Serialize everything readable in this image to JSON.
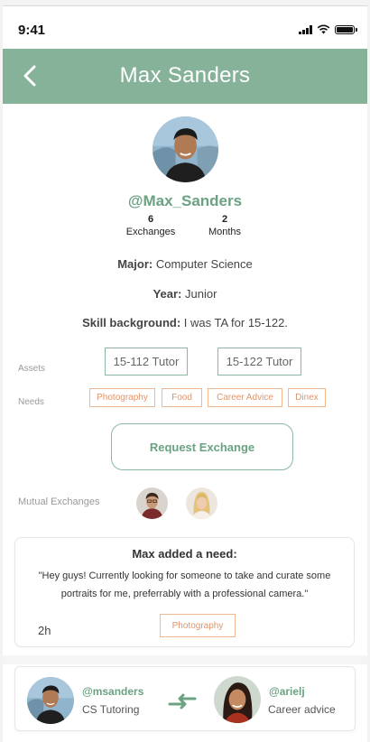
{
  "status_bar": {
    "time": "9:41"
  },
  "header": {
    "title": "Max Sanders",
    "back_icon": "chevron-left-icon"
  },
  "profile": {
    "handle": "@Max_Sanders",
    "stats": [
      {
        "value": "6",
        "label": "Exchanges"
      },
      {
        "value": "2",
        "label": "Months"
      }
    ],
    "major_label": "Major:",
    "major_value": "Computer Science",
    "year_label": "Year:",
    "year_value": "Junior",
    "skill_label": "Skill background:",
    "skill_value": "I was TA for 15-122."
  },
  "assets": {
    "label": "Assets",
    "items": [
      "15-112 Tutor",
      "15-122 Tutor"
    ]
  },
  "needs": {
    "label": "Needs",
    "items": [
      "Photography",
      "Food",
      "Career Advice",
      "Dinex"
    ]
  },
  "request_button": "Request Exchange",
  "mutual": {
    "label": "Mutual Exchanges"
  },
  "activity": {
    "title": "Max added a need:",
    "text": "\"Hey guys! Currently looking for someone to take and curate some portraits for me, preferrably with a professional camera.\"",
    "time": "2h",
    "tag": "Photography"
  },
  "exchange": {
    "left_handle": "@msanders",
    "left_skill": "CS Tutoring",
    "right_handle": "@arielj",
    "right_skill": "Career advice",
    "icon": "swap-arrows-icon"
  },
  "colors": {
    "brand_green": "#86b29a",
    "accent_green": "#6aa282",
    "need_orange": "#e0956a"
  }
}
